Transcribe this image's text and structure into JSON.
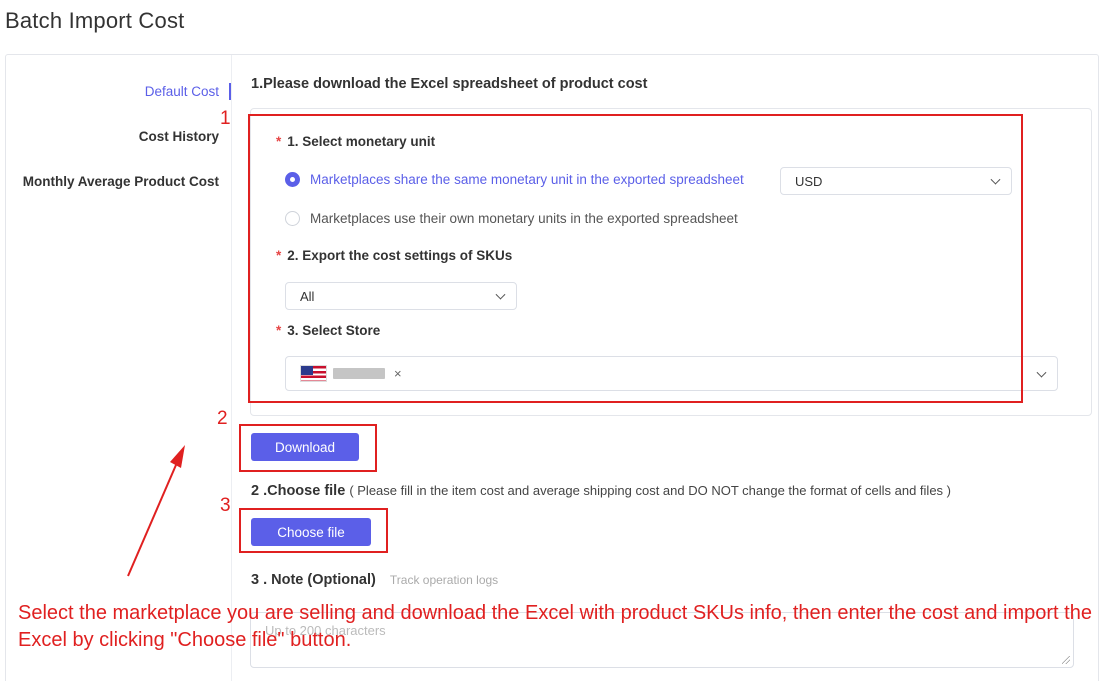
{
  "page": {
    "title": "Batch Import Cost"
  },
  "sidebar": {
    "items": [
      {
        "label": "Default Cost",
        "active": true
      },
      {
        "label": "Cost History",
        "active": false
      },
      {
        "label": "Monthly Average Product Cost",
        "active": false
      }
    ]
  },
  "step1": {
    "title": "1.Please download the Excel spreadsheet of product cost",
    "monetary": {
      "label": "1. Select monetary unit",
      "options": [
        {
          "label": "Marketplaces share the same monetary unit in the exported spreadsheet",
          "checked": true
        },
        {
          "label": "Marketplaces use their own monetary units in the exported spreadsheet",
          "checked": false
        }
      ],
      "currency_value": "USD"
    },
    "export": {
      "label": "2. Export the cost settings of SKUs",
      "value": "All"
    },
    "store": {
      "label": "3. Select Store",
      "tag_close": "×"
    }
  },
  "download": {
    "label": "Download"
  },
  "step2": {
    "title": "2 .Choose file",
    "hint": "( Please fill in the item cost and average shipping cost and DO NOT change the format of cells and files )",
    "button_label": "Choose file"
  },
  "step3": {
    "title": "3 . Note (Optional)",
    "hint": "Track operation logs",
    "placeholder": "Up to 200 characters"
  },
  "annotations": {
    "markers": [
      "1",
      "2",
      "3"
    ],
    "text": "Select the marketplace you are selling and download the Excel with product SKUs info, then enter the cost and import the Excel by clicking \"Choose file\" button.",
    "color": "#e02020"
  },
  "colors": {
    "accent": "#5b5fe8",
    "required": "#e64545"
  }
}
